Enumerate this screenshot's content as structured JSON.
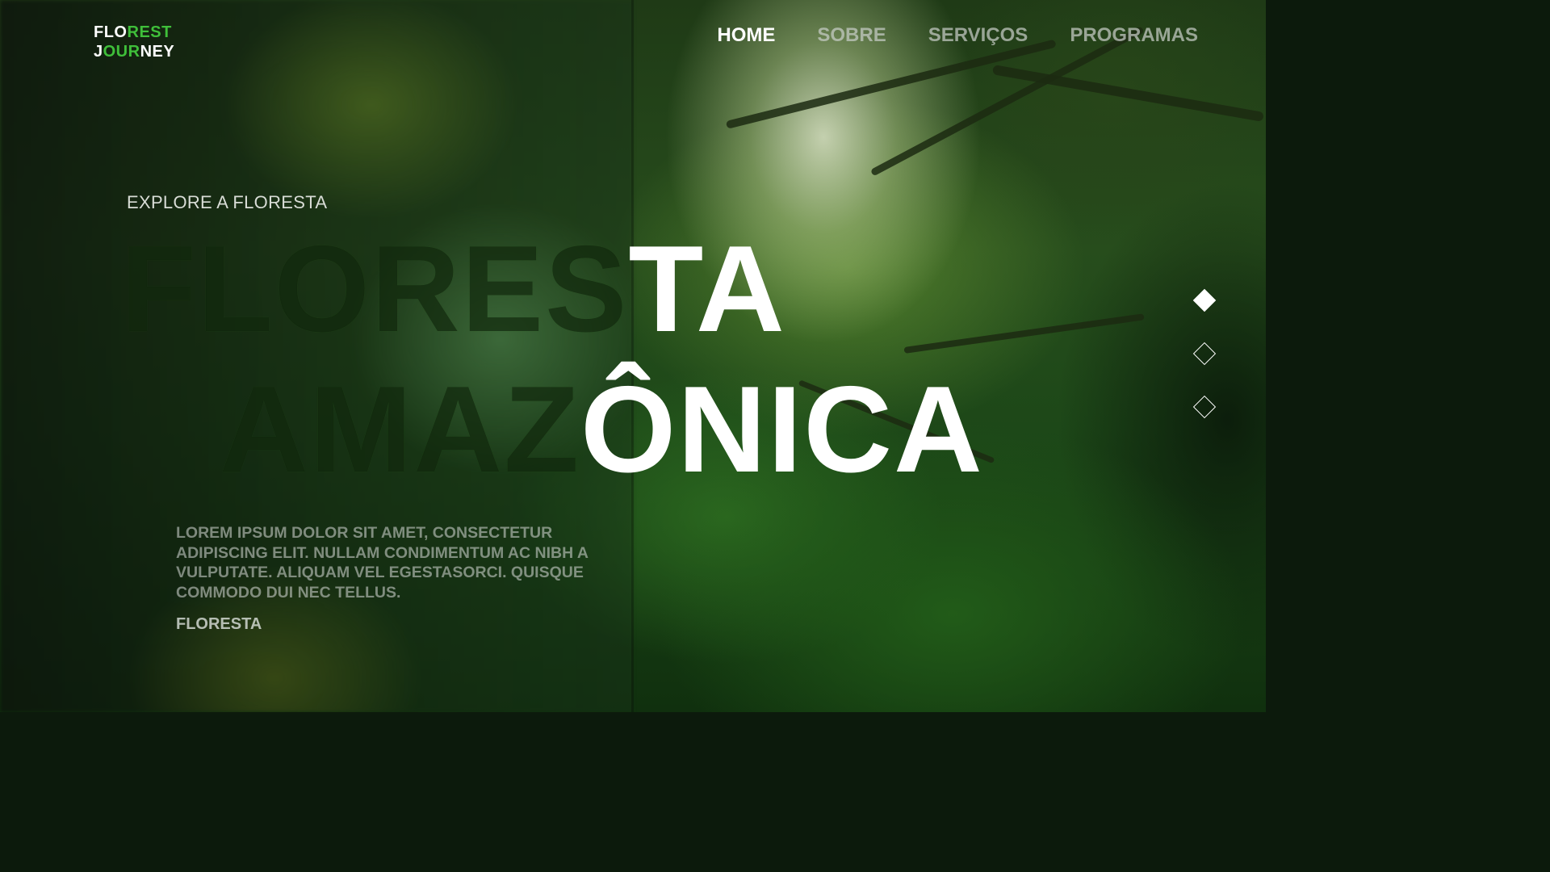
{
  "logo": {
    "line1_white": "FLO",
    "line1_green": "REST",
    "line2_white_a": "J",
    "line2_green": "OUR",
    "line2_white_b": "NEY"
  },
  "nav": {
    "items": [
      {
        "label": "HOME",
        "active": true
      },
      {
        "label": "SOBRE",
        "active": false
      },
      {
        "label": "SERVIÇOS",
        "active": false
      },
      {
        "label": "PROGRAMAS",
        "active": false
      }
    ]
  },
  "hero": {
    "eyebrow": "EXPLORE A FLORESTA",
    "title_line1_dark": "FLORES",
    "title_line1_light": "TA",
    "title_line2_dark": "AMAZ",
    "title_line2_light": "ÔNICA",
    "description": "LOREM IPSUM DOLOR SIT AMET, CONSECTETUR ADIPISCING ELIT. NULLAM CONDIMENTUM AC NIBH A VULPUTATE. ALIQUAM VEL EGESTASORCI. QUISQUE COMMODO DUI NEC TELLUS.",
    "tag": "FLORESTA"
  },
  "slider": {
    "active_index": 0,
    "count": 3
  },
  "colors": {
    "accent_green": "#3fbf3a",
    "text_white": "#ffffff"
  }
}
